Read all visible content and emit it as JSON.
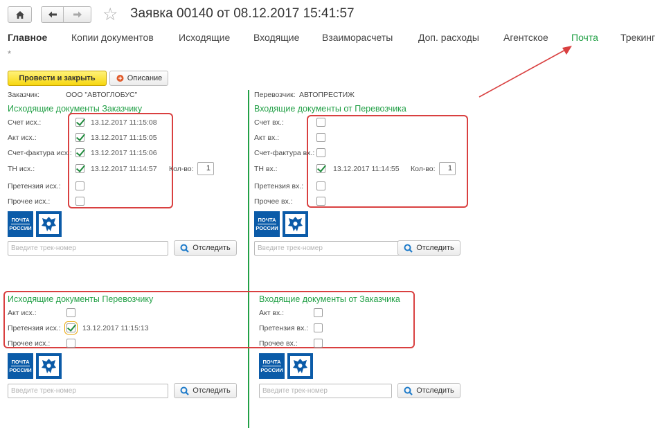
{
  "header": {
    "title": "Заявка 00140 от 08.12.2017 15:41:57",
    "home_icon": "home-icon",
    "back_icon": "arrow-left-icon",
    "forward_icon": "arrow-right-icon",
    "favorite_icon": "star-icon"
  },
  "tabs": [
    {
      "label": "Главное",
      "active": false
    },
    {
      "label": "Копии документов",
      "active": false
    },
    {
      "label": "Исходящие",
      "active": false
    },
    {
      "label": "Входящие",
      "active": false
    },
    {
      "label": "Взаиморасчеты",
      "active": false
    },
    {
      "label": "Доп. расходы",
      "active": false
    },
    {
      "label": "Агентское",
      "active": false
    },
    {
      "label": "Почта",
      "active": true
    },
    {
      "label": "Трекинг",
      "active": false
    }
  ],
  "asterisk": "*",
  "toolbar": {
    "post_close": "Провести и закрыть",
    "description": "Описание"
  },
  "customer": {
    "label": "Заказчик:",
    "value": "ООО \"АВТОГЛОБУС\""
  },
  "carrier": {
    "label": "Перевозчик:",
    "value": "АВТОПРЕСТИЖ"
  },
  "out_customer": {
    "title": "Исходящие документы Заказчику",
    "rows": [
      {
        "label": "Счет исх.:",
        "checked": true,
        "date": "13.12.2017 11:15:08"
      },
      {
        "label": "Акт исх.:",
        "checked": true,
        "date": "13.12.2017 11:15:05"
      },
      {
        "label": "Счет-фактура исх.:",
        "checked": true,
        "date": "13.12.2017 11:15:06"
      },
      {
        "label": "ТН исх.:",
        "checked": true,
        "date": "13.12.2017 11:14:57"
      },
      {
        "label": "Претензия исх.:",
        "checked": false,
        "date": ""
      },
      {
        "label": "Прочее исх.:",
        "checked": false,
        "date": ""
      }
    ],
    "qty_label": "Кол-во:",
    "qty_value": "1"
  },
  "in_carrier": {
    "title": "Входящие документы от Перевозчика",
    "rows": [
      {
        "label": "Счет вх.:",
        "checked": false,
        "date": ""
      },
      {
        "label": "Акт вх.:",
        "checked": false,
        "date": ""
      },
      {
        "label": "Счет-фактура вх.:",
        "checked": false,
        "date": ""
      },
      {
        "label": "ТН вх.:",
        "checked": true,
        "date": "13.12.2017 11:14:55"
      },
      {
        "label": "Претензия вх.:",
        "checked": false,
        "date": ""
      },
      {
        "label": "Прочее вх.:",
        "checked": false,
        "date": ""
      }
    ],
    "qty_label": "Кол-во:",
    "qty_value": "1"
  },
  "out_carrier": {
    "title": "Исходящие документы Перевозчику",
    "rows": [
      {
        "label": "Акт исх.:",
        "checked": false,
        "date": ""
      },
      {
        "label": "Претензия исх.:",
        "checked": true,
        "date": "13.12.2017 11:15:13"
      },
      {
        "label": "Прочее исх.:",
        "checked": false,
        "date": ""
      }
    ]
  },
  "in_customer": {
    "title": "Входящие документы от Заказчика",
    "rows": [
      {
        "label": "Акт вх.:",
        "checked": false
      },
      {
        "label": "Претензия вх.:",
        "checked": false
      },
      {
        "label": "Прочее вх.:",
        "checked": false
      }
    ]
  },
  "post_logo": {
    "line1": "ПОЧТА",
    "line2": "РОССИИ"
  },
  "tracking": {
    "placeholder": "Введите трек-номер",
    "button": "Отследить",
    "search_icon": "search-icon"
  },
  "colors": {
    "accent_green": "#22a046",
    "highlight_red": "#d94040",
    "primary_yellow": "#f7d710",
    "post_blue": "#0b5ba8"
  }
}
